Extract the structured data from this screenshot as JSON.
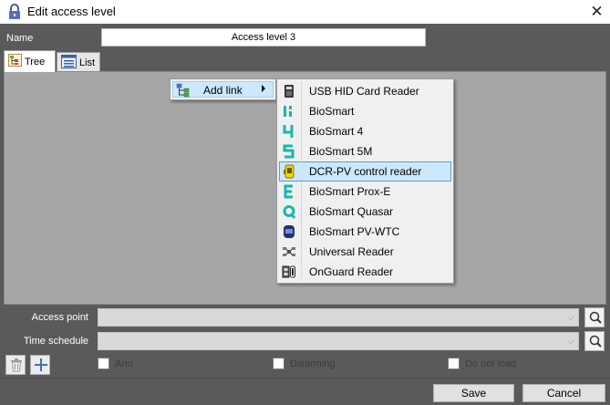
{
  "window": {
    "title": "Edit access level",
    "close_glyph": "✕"
  },
  "name_field": {
    "label": "Name",
    "value": "Access level 3"
  },
  "tabs": [
    {
      "label": "Tree",
      "icon": "tree-view-icon",
      "active": true
    },
    {
      "label": "List",
      "icon": "list-view-icon",
      "active": false
    }
  ],
  "context_menu": {
    "item": {
      "label": "Add link",
      "icon": "add-link-icon"
    },
    "submenu": [
      {
        "label": "USB HID Card Reader",
        "icon": "usb-card-reader-icon",
        "selected": false
      },
      {
        "label": "BioSmart",
        "icon": "biosmart-icon",
        "selected": false
      },
      {
        "label": "BioSmart  4",
        "icon": "biosmart-4-icon",
        "selected": false
      },
      {
        "label": "BioSmart 5M",
        "icon": "biosmart-5m-icon",
        "selected": false
      },
      {
        "label": "DCR-PV control reader",
        "icon": "dcr-pv-reader-icon",
        "selected": true
      },
      {
        "label": "BioSmart Prox-E",
        "icon": "biosmart-prox-e-icon",
        "selected": false
      },
      {
        "label": "BioSmart Quasar",
        "icon": "biosmart-quasar-icon",
        "selected": false
      },
      {
        "label": "BioSmart PV-WTC",
        "icon": "biosmart-pv-wtc-icon",
        "selected": false
      },
      {
        "label": "Universal Reader",
        "icon": "universal-reader-icon",
        "selected": false
      },
      {
        "label": "OnGuard Reader",
        "icon": "onguard-reader-icon",
        "selected": false
      }
    ]
  },
  "fields": {
    "access_point": {
      "label": "Access point",
      "value": ""
    },
    "time_schedule": {
      "label": "Time schedule",
      "value": ""
    }
  },
  "checkboxes": [
    {
      "label": "Arm",
      "checked": false
    },
    {
      "label": "Disarming",
      "checked": false
    },
    {
      "label": "Do not load",
      "checked": false
    }
  ],
  "buttons": {
    "save": "Save",
    "cancel": "Cancel"
  },
  "colors": {
    "accent_teal": "#19b6b0",
    "selection": "#cce8ff",
    "panel_bg": "#a6a6a6",
    "dialog_bg": "#5a5a5a"
  }
}
